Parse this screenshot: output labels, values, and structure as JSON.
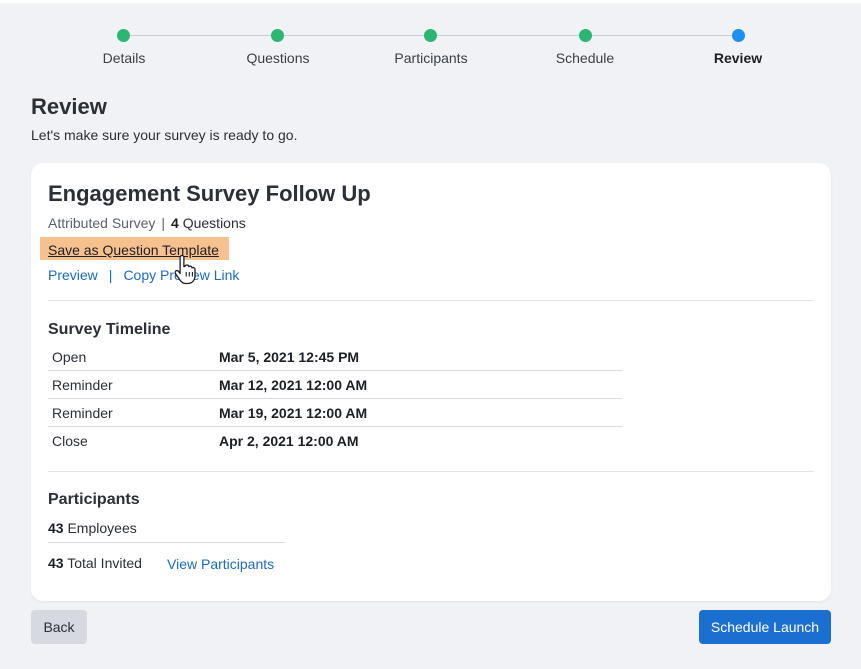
{
  "stepper": {
    "steps": [
      {
        "label": "Details",
        "state": "complete"
      },
      {
        "label": "Questions",
        "state": "complete"
      },
      {
        "label": "Participants",
        "state": "complete"
      },
      {
        "label": "Schedule",
        "state": "complete"
      },
      {
        "label": "Review",
        "state": "current"
      }
    ]
  },
  "page": {
    "title": "Review",
    "subtitle": "Let's make sure your survey is ready to go."
  },
  "survey": {
    "title": "Engagement Survey Follow Up",
    "type": "Attributed Survey",
    "separator": "|",
    "question_count": "4",
    "question_word": "Questions",
    "save_template_label": "Save as Question Template",
    "preview_label": "Preview",
    "link_separator": "|",
    "copy_link_label": "Copy Preview Link"
  },
  "timeline": {
    "title": "Survey Timeline",
    "rows": [
      {
        "label": "Open",
        "value": "Mar 5, 2021 12:45 PM"
      },
      {
        "label": "Reminder",
        "value": "Mar 12, 2021 12:00 AM"
      },
      {
        "label": "Reminder",
        "value": "Mar 19, 2021 12:00 AM"
      },
      {
        "label": "Close",
        "value": "Apr 2, 2021 12:00 AM"
      }
    ]
  },
  "participants": {
    "title": "Participants",
    "employees_count": "43",
    "employees_label": "Employees",
    "total_count": "43",
    "total_label": "Total Invited",
    "view_label": "View Participants"
  },
  "footer": {
    "back_label": "Back",
    "launch_label": "Schedule Launch"
  },
  "icons": {
    "cursor": "hand-pointer-icon",
    "step_complete": "check-dot-icon",
    "step_current": "current-dot-icon"
  },
  "colors": {
    "step_complete": "#2bb673",
    "step_current": "#1f8ef1",
    "link": "#1a6cc4",
    "primary_button": "#1a6fd1",
    "highlight": "#f6c08f"
  }
}
